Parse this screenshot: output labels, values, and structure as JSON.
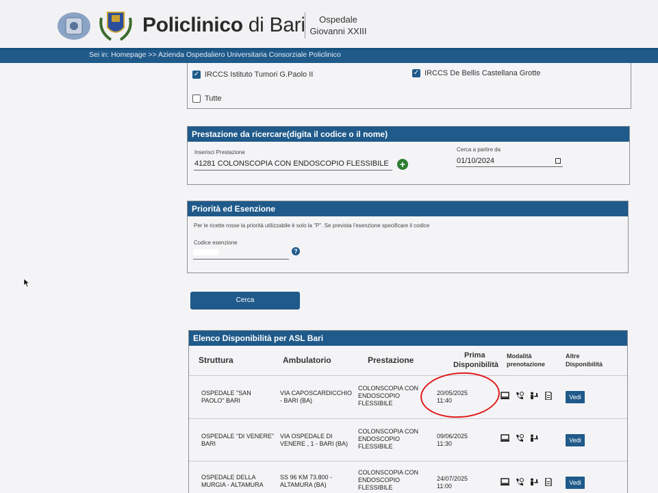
{
  "header": {
    "brand_bold": "Policlinico",
    "brand_light": " di Bari",
    "hospital_line1": "Ospedale",
    "hospital_line2": "Giovanni XXIII"
  },
  "breadcrumb": "Sei in: Homepage >> Azienda Ospedaliero Universitaria Consorziale Policlinico",
  "structures": {
    "items": [
      {
        "label": "IRCCS Istituto Tumori G.Paolo II",
        "checked": true
      },
      {
        "label": "IRCCS De Bellis Castellana Grotte",
        "checked": true
      },
      {
        "label": "Tutte",
        "checked": false
      }
    ]
  },
  "prestazione": {
    "title": "Prestazione da ricercare(digita il codice o il nome)",
    "input_label": "Inserisci Prestazione",
    "input_value": "41281 COLONSCOPIA CON ENDOSCOPIO FLESSIBILE",
    "date_label": "Cerca a partire da",
    "date_value": "01/10/2024"
  },
  "priorita": {
    "title": "Priorità ed Esenzione",
    "note": "Per le ricette rosse la priorità utilizzabile è solo la \"P\". Se prevista l'esenzione specificare il codice",
    "field_label": "Codice esenzione"
  },
  "search_button": "Cerca",
  "results": {
    "title": "Elenco Disponibilità per ASL Bari",
    "columns": {
      "struttura": "Struttura",
      "ambulatorio": "Ambulatorio",
      "prestazione": "Prestazione",
      "prima_1": "Prima",
      "prima_2": "Disponibilità",
      "modalita_1": "Modalità",
      "modalita_2": "prenotazione",
      "altre_1": "Altre",
      "altre_2": "Disponibilità"
    },
    "rows": [
      {
        "struttura_1": "OSPEDALE \"SAN",
        "struttura_2": "PAOLO\" BARI",
        "ambulatorio_1": "VIA CAPOSCARDICCHIO",
        "ambulatorio_2": "- BARI (BA)",
        "prestazione_1": "COLONSCOPIA CON",
        "prestazione_2": "ENDOSCOPIO",
        "prestazione_3": "FLESSIBILE",
        "date": "20/05/2025",
        "time": "11:40",
        "vedi": "Vedi"
      },
      {
        "struttura_1": "OSPEDALE \"DI VENERE\"",
        "struttura_2": "BARI",
        "ambulatorio_1": "VIA OSPEDALE DI",
        "ambulatorio_2": "VENERE , 1 - BARI (BA)",
        "prestazione_1": "COLONSCOPIA CON",
        "prestazione_2": "ENDOSCOPIO",
        "prestazione_3": "FLESSIBILE",
        "date": "09/06/2025",
        "time": "11:30",
        "vedi": "Vedi"
      },
      {
        "struttura_1": "OSPEDALE DELLA",
        "struttura_2": "MURGIA - ALTAMURA",
        "ambulatorio_1": "SS 96 KM 73.800 -",
        "ambulatorio_2": "ALTAMURA (BA)",
        "prestazione_1": "COLONSCOPIA CON",
        "prestazione_2": "ENDOSCOPIO",
        "prestazione_3": "FLESSIBILE",
        "date": "24/07/2025",
        "time": "11:00",
        "vedi": "Vedi"
      }
    ]
  },
  "colors": {
    "primary": "#1f5a8a",
    "add": "#2e7d32",
    "annotation": "#e01818"
  }
}
